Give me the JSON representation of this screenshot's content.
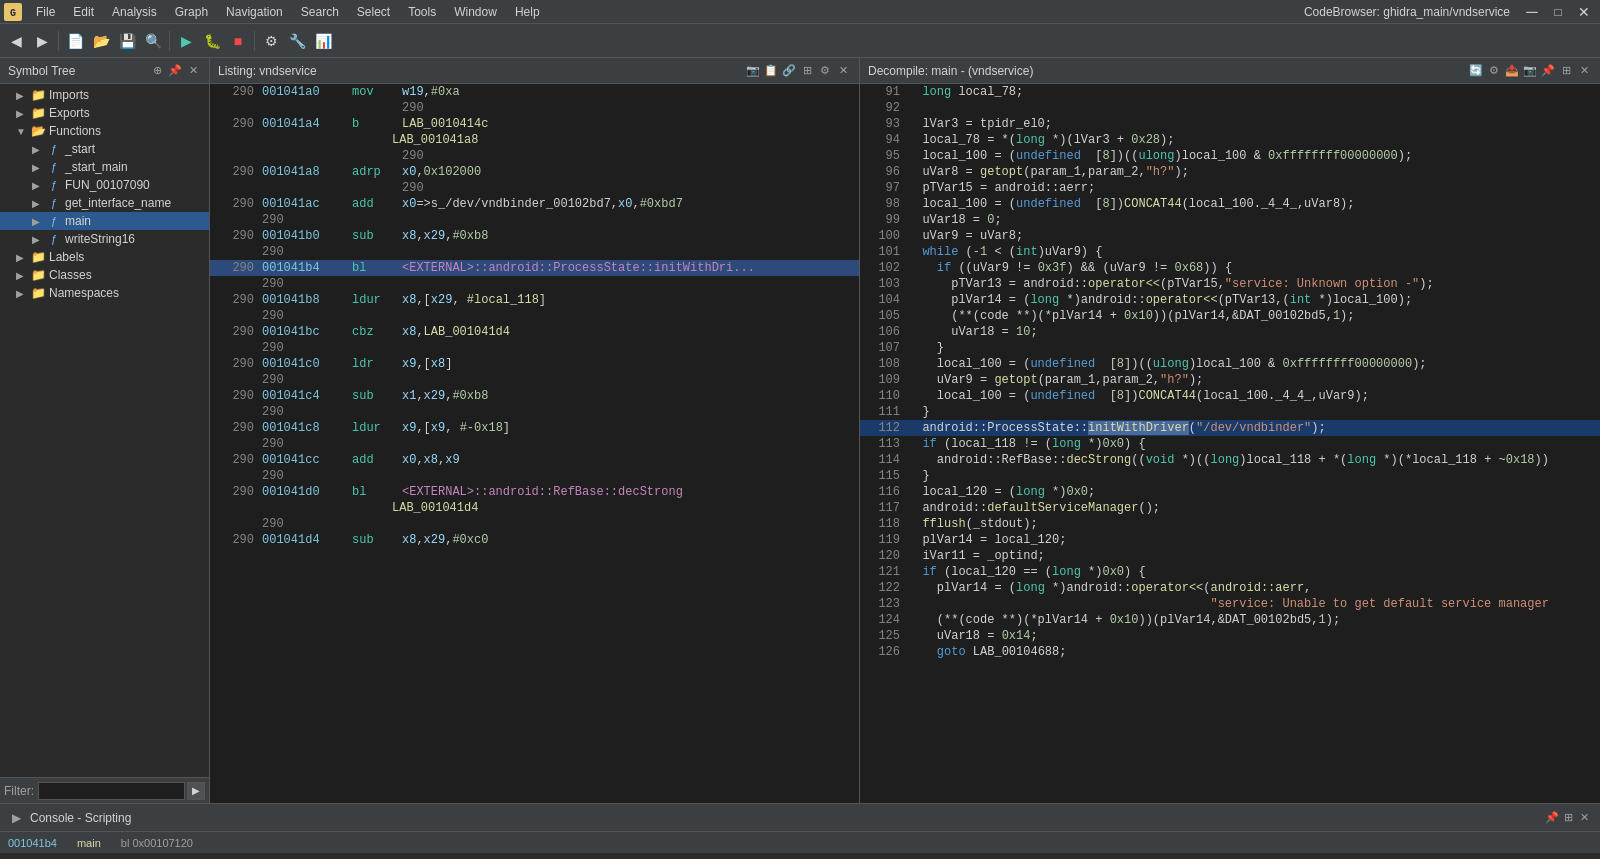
{
  "app": {
    "title": "CodeBrowser: ghidra_main/vndservice"
  },
  "menubar": {
    "items": [
      "File",
      "Edit",
      "Analysis",
      "Graph",
      "Navigation",
      "Search",
      "Select",
      "Tools",
      "Window",
      "Help"
    ]
  },
  "symbol_tree": {
    "header": "Symbol Tree",
    "items": [
      {
        "id": "imports",
        "label": "Imports",
        "type": "folder",
        "level": 0,
        "expanded": false
      },
      {
        "id": "exports",
        "label": "Exports",
        "type": "folder",
        "level": 0,
        "expanded": false
      },
      {
        "id": "functions",
        "label": "Functions",
        "type": "folder",
        "level": 0,
        "expanded": true
      },
      {
        "id": "_start",
        "label": "_start",
        "type": "func",
        "level": 1
      },
      {
        "id": "_start_main",
        "label": "_start_main",
        "type": "func",
        "level": 1
      },
      {
        "id": "FUN_00107090",
        "label": "FUN_00107090",
        "type": "func",
        "level": 1
      },
      {
        "id": "get_interface_name",
        "label": "get_interface_name",
        "type": "func",
        "level": 1
      },
      {
        "id": "main",
        "label": "main",
        "type": "func",
        "level": 1,
        "selected": true
      },
      {
        "id": "writeString16",
        "label": "writeString16",
        "type": "func",
        "level": 1
      },
      {
        "id": "labels",
        "label": "Labels",
        "type": "folder",
        "level": 0,
        "expanded": false
      },
      {
        "id": "classes",
        "label": "Classes",
        "type": "folder",
        "level": 0,
        "expanded": false
      },
      {
        "id": "namespaces",
        "label": "Namespaces",
        "type": "folder",
        "level": 0,
        "expanded": false
      }
    ]
  },
  "listing": {
    "header": "Listing: vndservice",
    "lines": [
      {
        "num": "290",
        "addr": "001041a0",
        "mnem": "mov",
        "ops": "w19,#0xa",
        "type": "code"
      },
      {
        "num": "290",
        "addr": "001041a4",
        "mnem": "b",
        "ops": "LAB_0010414c",
        "type": "code",
        "ops_type": "label"
      },
      {
        "num": "",
        "addr": "",
        "mnem": "",
        "ops": "LAB_001041a8",
        "type": "label"
      },
      {
        "num": "290",
        "addr": "001041a8",
        "mnem": "adrp",
        "ops": "x0,0x102000",
        "type": "code"
      },
      {
        "num": "290",
        "addr": "001041ac",
        "mnem": "add",
        "ops": "x0=>s_/dev/vndbinder_00102bd7,x0,#0xbd7",
        "type": "code"
      },
      {
        "num": "290",
        "addr": "001041b0",
        "mnem": "sub",
        "ops": "x8,x29,#0xb8",
        "type": "code"
      },
      {
        "num": "290",
        "addr": "001041b4",
        "mnem": "bl",
        "ops": "<EXTERNAL>::android::ProcessState::initWithDri...",
        "type": "code",
        "highlighted": true
      },
      {
        "num": "290",
        "addr": "001041b8",
        "mnem": "ldur",
        "ops": "x8,[x29, #local_118]",
        "type": "code"
      },
      {
        "num": "290",
        "addr": "001041bc",
        "mnem": "cbz",
        "ops": "x8,LAB_001041d4",
        "type": "code"
      },
      {
        "num": "290",
        "addr": "001041c0",
        "mnem": "ldr",
        "ops": "x9,[x8]",
        "type": "code"
      },
      {
        "num": "290",
        "addr": "001041c4",
        "mnem": "sub",
        "ops": "x1,x29,#0xb8",
        "type": "code"
      },
      {
        "num": "290",
        "addr": "001041c8",
        "mnem": "ldur",
        "ops": "x9,[x9, #-0x18]",
        "type": "code"
      },
      {
        "num": "290",
        "addr": "001041cc",
        "mnem": "add",
        "ops": "x0,x8,x9",
        "type": "code"
      },
      {
        "num": "290",
        "addr": "001041d0",
        "mnem": "bl",
        "ops": "<EXTERNAL>::android::RefBase::decStrong",
        "type": "code"
      },
      {
        "num": "",
        "addr": "",
        "mnem": "",
        "ops": "LAB_001041d4",
        "type": "label"
      },
      {
        "num": "290",
        "addr": "001041d4",
        "mnem": "sub",
        "ops": "x8,x29,#0xc0",
        "type": "code"
      }
    ]
  },
  "decompile": {
    "header": "Decompile: main - (vndservice)",
    "lines": [
      {
        "num": "91",
        "code": "  long local_78;"
      },
      {
        "num": "92",
        "code": ""
      },
      {
        "num": "93",
        "code": "  lVar3 = tpidr_el0;"
      },
      {
        "num": "94",
        "code": "  local_78 = *(long *)(lVar3 + 0x28);"
      },
      {
        "num": "95",
        "code": "  local_100 = (undefined  [8])((ulong)local_100 & 0xffffffff00000000);"
      },
      {
        "num": "96",
        "code": "  uVar8 = getopt(param_1,param_2,\"h?\");"
      },
      {
        "num": "97",
        "code": "  pTVar15 = android::aerr;"
      },
      {
        "num": "98",
        "code": "  local_100 = (undefined  [8])CONCAT44(local_100._4_4_,uVar8);"
      },
      {
        "num": "99",
        "code": "  uVar18 = 0;"
      },
      {
        "num": "100",
        "code": "  uVar9 = uVar8;"
      },
      {
        "num": "101",
        "code": "  while (-1 < (int)uVar9) {"
      },
      {
        "num": "102",
        "code": "    if ((uVar9 != 0x3f) && (uVar9 != 0x68)) {"
      },
      {
        "num": "103",
        "code": "      pTVar13 = android::operator<<(pTVar15,\"service: Unknown option -\");"
      },
      {
        "num": "104",
        "code": "      plVar14 = (long *)android::operator<<(pTVar13,(int *)local_100);"
      },
      {
        "num": "105",
        "code": "      (**( code **)(*plVar14 + 0x10))(plVar14,&DAT_00102bd5,1);"
      },
      {
        "num": "106",
        "code": "      uVar18 = 10;"
      },
      {
        "num": "107",
        "code": "    }"
      },
      {
        "num": "108",
        "code": "    local_100 = (undefined  [8])((ulong)local_100 & 0xffffffff00000000);"
      },
      {
        "num": "109",
        "code": "    uVar9 = getopt(param_1,param_2,\"h?\");"
      },
      {
        "num": "110",
        "code": "    local_100 = (undefined  [8])CONCAT44(local_100._4_4_,uVar9);"
      },
      {
        "num": "111",
        "code": "  }"
      },
      {
        "num": "112",
        "code": "  android::ProcessState::initWithDriver(\"/dev/vndbinder\");",
        "highlight": true
      },
      {
        "num": "113",
        "code": "  if (local_118 != (long *)0x0) {"
      },
      {
        "num": "114",
        "code": "    android::RefBase::decStrong((void *)((long)local_118 + *(long *)(*local_118 + ~0x18))"
      },
      {
        "num": "115",
        "code": "  }"
      },
      {
        "num": "116",
        "code": "  local_120 = (long *)0x0;"
      },
      {
        "num": "117",
        "code": "  android::defaultServiceManager();"
      },
      {
        "num": "118",
        "code": "  fflush(_stdout);"
      },
      {
        "num": "119",
        "code": "  plVar14 = local_120;"
      },
      {
        "num": "120",
        "code": "  iVar11 = _optind;"
      },
      {
        "num": "121",
        "code": "  if (local_120 == (long *)0x0) {"
      },
      {
        "num": "122",
        "code": "    plVar14 = (long *)android::operator<<(android::aerr,"
      },
      {
        "num": "123",
        "code": "                                          \"service: Unable to get default service manager"
      },
      {
        "num": "124",
        "code": "    (**( code **)(*plVar14 + 0x10))(plVar14,&DAT_00102bd5,1);"
      },
      {
        "num": "125",
        "code": "    uVar18 = 0x14;"
      },
      {
        "num": "126",
        "code": "    goto LAB_00104688;"
      }
    ]
  },
  "console": {
    "label": "Console - Scripting"
  },
  "statusbar": {
    "addr": "001041b4",
    "func": "main",
    "extra": "bl 0x00107120"
  },
  "filter": {
    "label": "Filter:",
    "placeholder": ""
  }
}
